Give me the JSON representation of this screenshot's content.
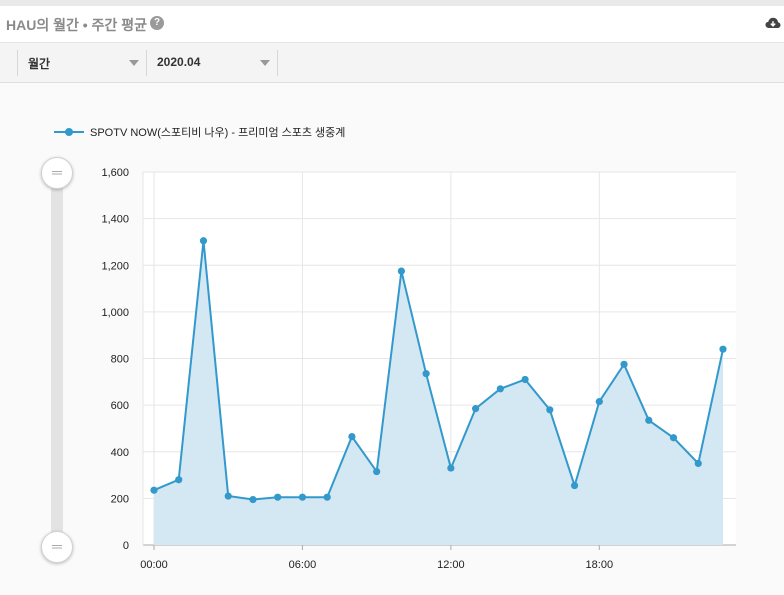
{
  "header": {
    "title": "HAU의 월간 • 주간 평균",
    "help_icon": "question-circle-icon",
    "download_icon": "cloud-download-icon"
  },
  "toolbar": {
    "period_value": "월간",
    "month_value": "2020.04"
  },
  "slider": {
    "handle_icon": "drag-handle-icon"
  },
  "colors": {
    "series": "#3399cc",
    "area": "#d3e8f2"
  },
  "chart_data": {
    "type": "area",
    "title": "",
    "xlabel": "",
    "ylabel": "",
    "x_tick_labels": [
      "00:00",
      "06:00",
      "12:00",
      "18:00"
    ],
    "y_tick_labels": [
      "0",
      "200",
      "400",
      "600",
      "800",
      "1,000",
      "1,200",
      "1,400",
      "1,600"
    ],
    "ylim": [
      0,
      1600
    ],
    "xlim": [
      0,
      23
    ],
    "grid": true,
    "legend_position": "top-left",
    "series": [
      {
        "name": "SPOTV NOW(스포티비 나우) - 프리미엄 스포츠 생중계",
        "x": [
          0,
          1,
          2,
          3,
          4,
          5,
          6,
          7,
          8,
          9,
          10,
          11,
          12,
          13,
          14,
          15,
          16,
          17,
          18,
          19,
          20,
          21,
          22,
          23
        ],
        "values": [
          235,
          280,
          1305,
          210,
          195,
          205,
          205,
          205,
          465,
          315,
          1175,
          735,
          330,
          585,
          670,
          710,
          580,
          255,
          615,
          775,
          535,
          460,
          350,
          840
        ]
      }
    ]
  }
}
